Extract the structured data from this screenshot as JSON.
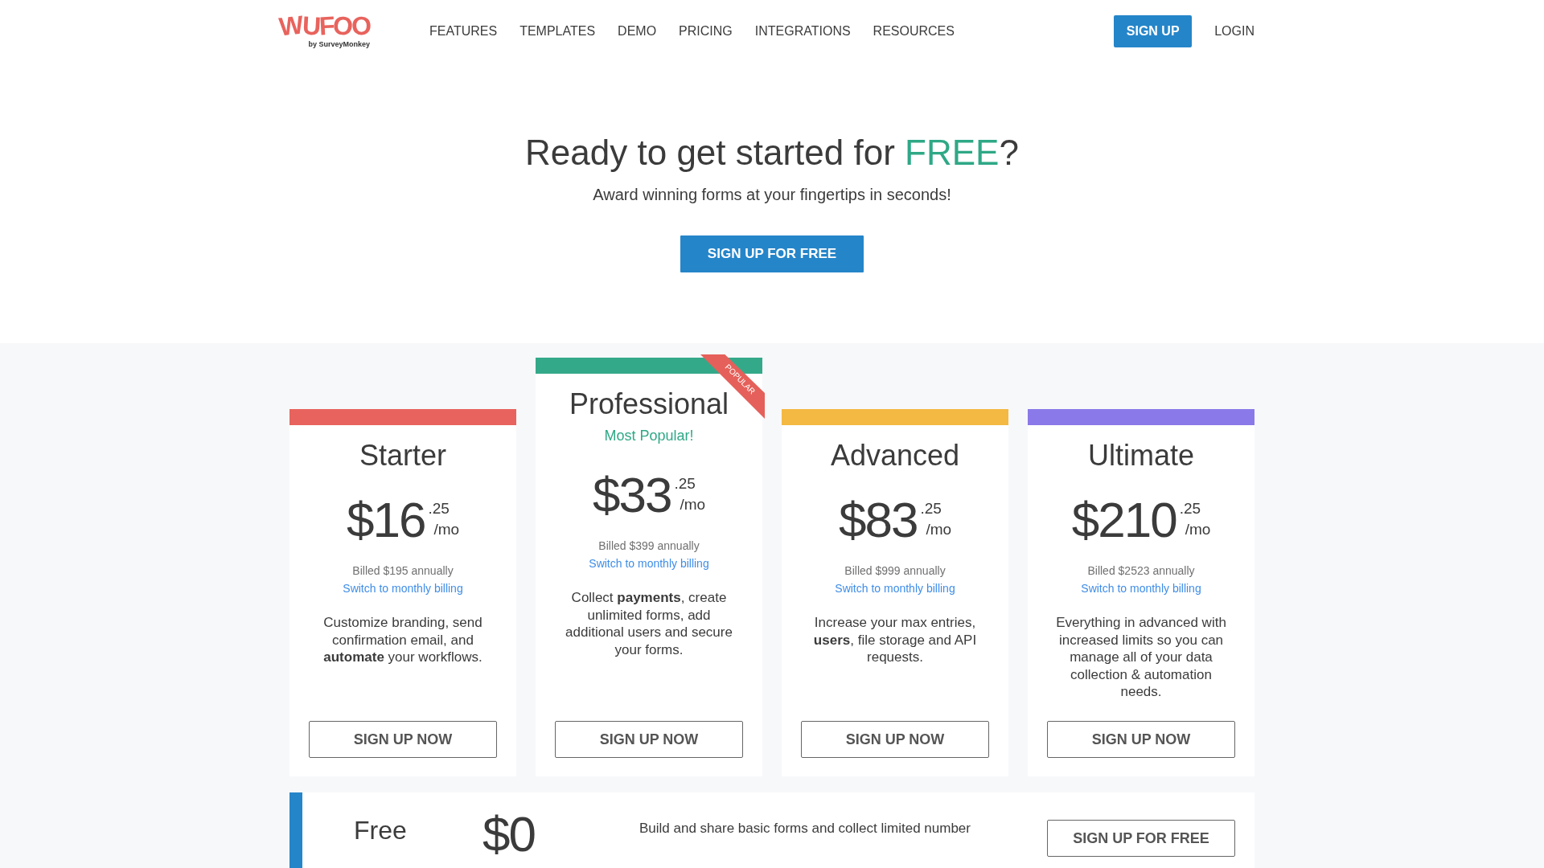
{
  "header": {
    "logo": {
      "wordmark": "WUFOO",
      "byline": "by SurveyMonkey"
    },
    "nav": [
      "FEATURES",
      "TEMPLATES",
      "DEMO",
      "PRICING",
      "INTEGRATIONS",
      "RESOURCES"
    ],
    "signup_button": "SIGN UP",
    "login_link": "LOGIN"
  },
  "hero": {
    "title": "Ready to get started for ",
    "title_highlight": "FREE",
    "title_end": "?",
    "subtitle": "Award winning forms at your fingertips in seconds!",
    "cta_button": "SIGN UP FOR FREE"
  },
  "plans": [
    {
      "name": "Starter",
      "color": "#e8635d",
      "featured": false,
      "price": "$16",
      "cents": ".25",
      "period": "/mo",
      "billed": "Billed $195 annually",
      "billing_link": "Switch to monthly billing",
      "description": "Customize branding, send confirmation email, and **automate** your workflows.",
      "button": "SIGN UP NOW"
    },
    {
      "name": "Professional",
      "color": "#34a98a",
      "featured": true,
      "ribbon": "POPULAR",
      "tagline": "Most Popular!",
      "price": "$33",
      "cents": ".25",
      "period": "/mo",
      "billed": "Billed $399 annually",
      "billing_link": "Switch to monthly billing",
      "description": "Collect **payments**, create unlimited forms, add additional users and secure your forms.",
      "button": "SIGN UP NOW"
    },
    {
      "name": "Advanced",
      "color": "#f4b942",
      "featured": false,
      "price": "$83",
      "cents": ".25",
      "period": "/mo",
      "billed": "Billed $999 annually",
      "billing_link": "Switch to monthly billing",
      "description": "Increase your max entries, **users**, file storage and API requests.",
      "button": "SIGN UP NOW"
    },
    {
      "name": "Ultimate",
      "color": "#8a79e8",
      "featured": false,
      "price": "$210",
      "cents": ".25",
      "period": "/mo",
      "billed": "Billed $2523 annually",
      "billing_link": "Switch to monthly billing",
      "description": "Everything in advanced with increased limits so you can manage all of your data collection & automation needs.",
      "button": "SIGN UP NOW"
    }
  ],
  "free_plan": {
    "name": "Free",
    "price": "$0",
    "description": "Build and share basic forms and collect limited number",
    "button": "SIGN UP FOR FREE"
  }
}
